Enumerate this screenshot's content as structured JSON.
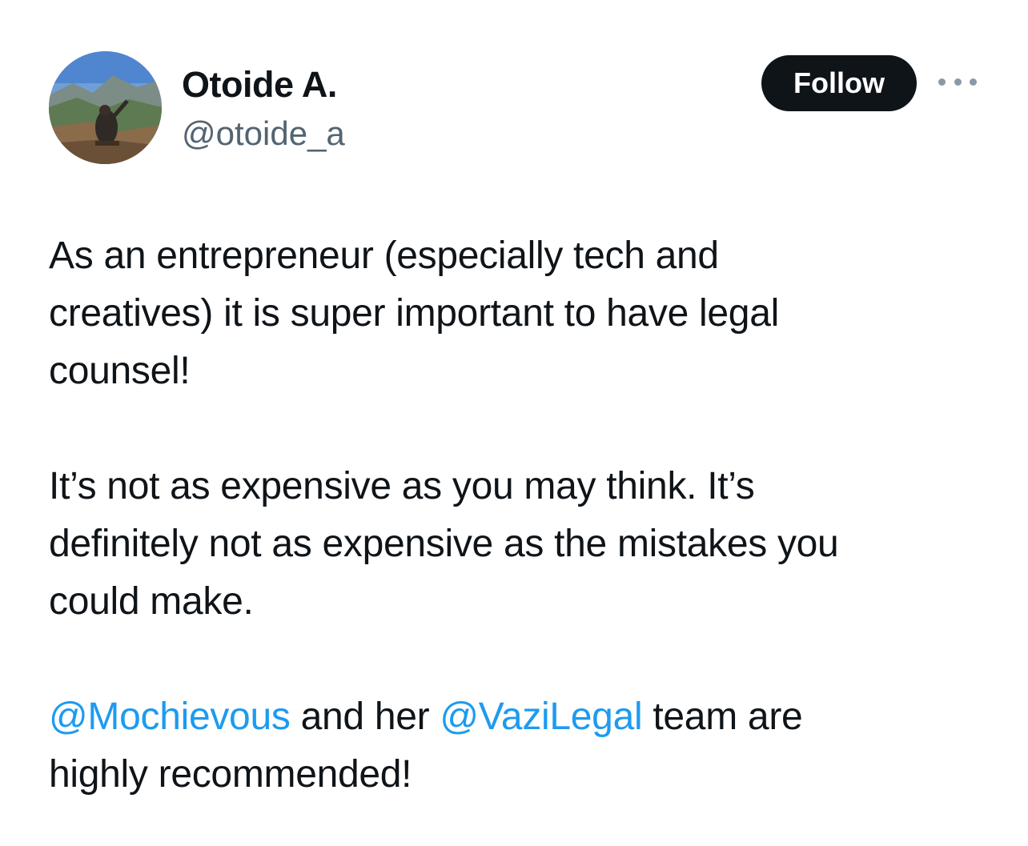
{
  "author": {
    "display_name": "Otoide A.",
    "handle": "@otoide_a"
  },
  "actions": {
    "follow_label": "Follow",
    "more_icon": "more-horizontal-icon"
  },
  "tweet": {
    "paragraphs": [
      {
        "lines": [
          "As an entrepreneur (especially tech and",
          "creatives) it is super important to have legal",
          "counsel!"
        ]
      },
      {
        "lines": [
          "It’s not as expensive as you may think. It’s",
          "definitely not as expensive as the mistakes you",
          "could make."
        ]
      },
      {
        "mention_1": "@Mochievous",
        "text_1": " and her ",
        "mention_2": "@VaziLegal",
        "text_2": " team are",
        "line_2": "highly recommended!"
      }
    ]
  },
  "colors": {
    "text": "#0f1419",
    "secondary": "#536471",
    "link": "#1d9bf0",
    "follow_button_bg": "#0f1419"
  }
}
